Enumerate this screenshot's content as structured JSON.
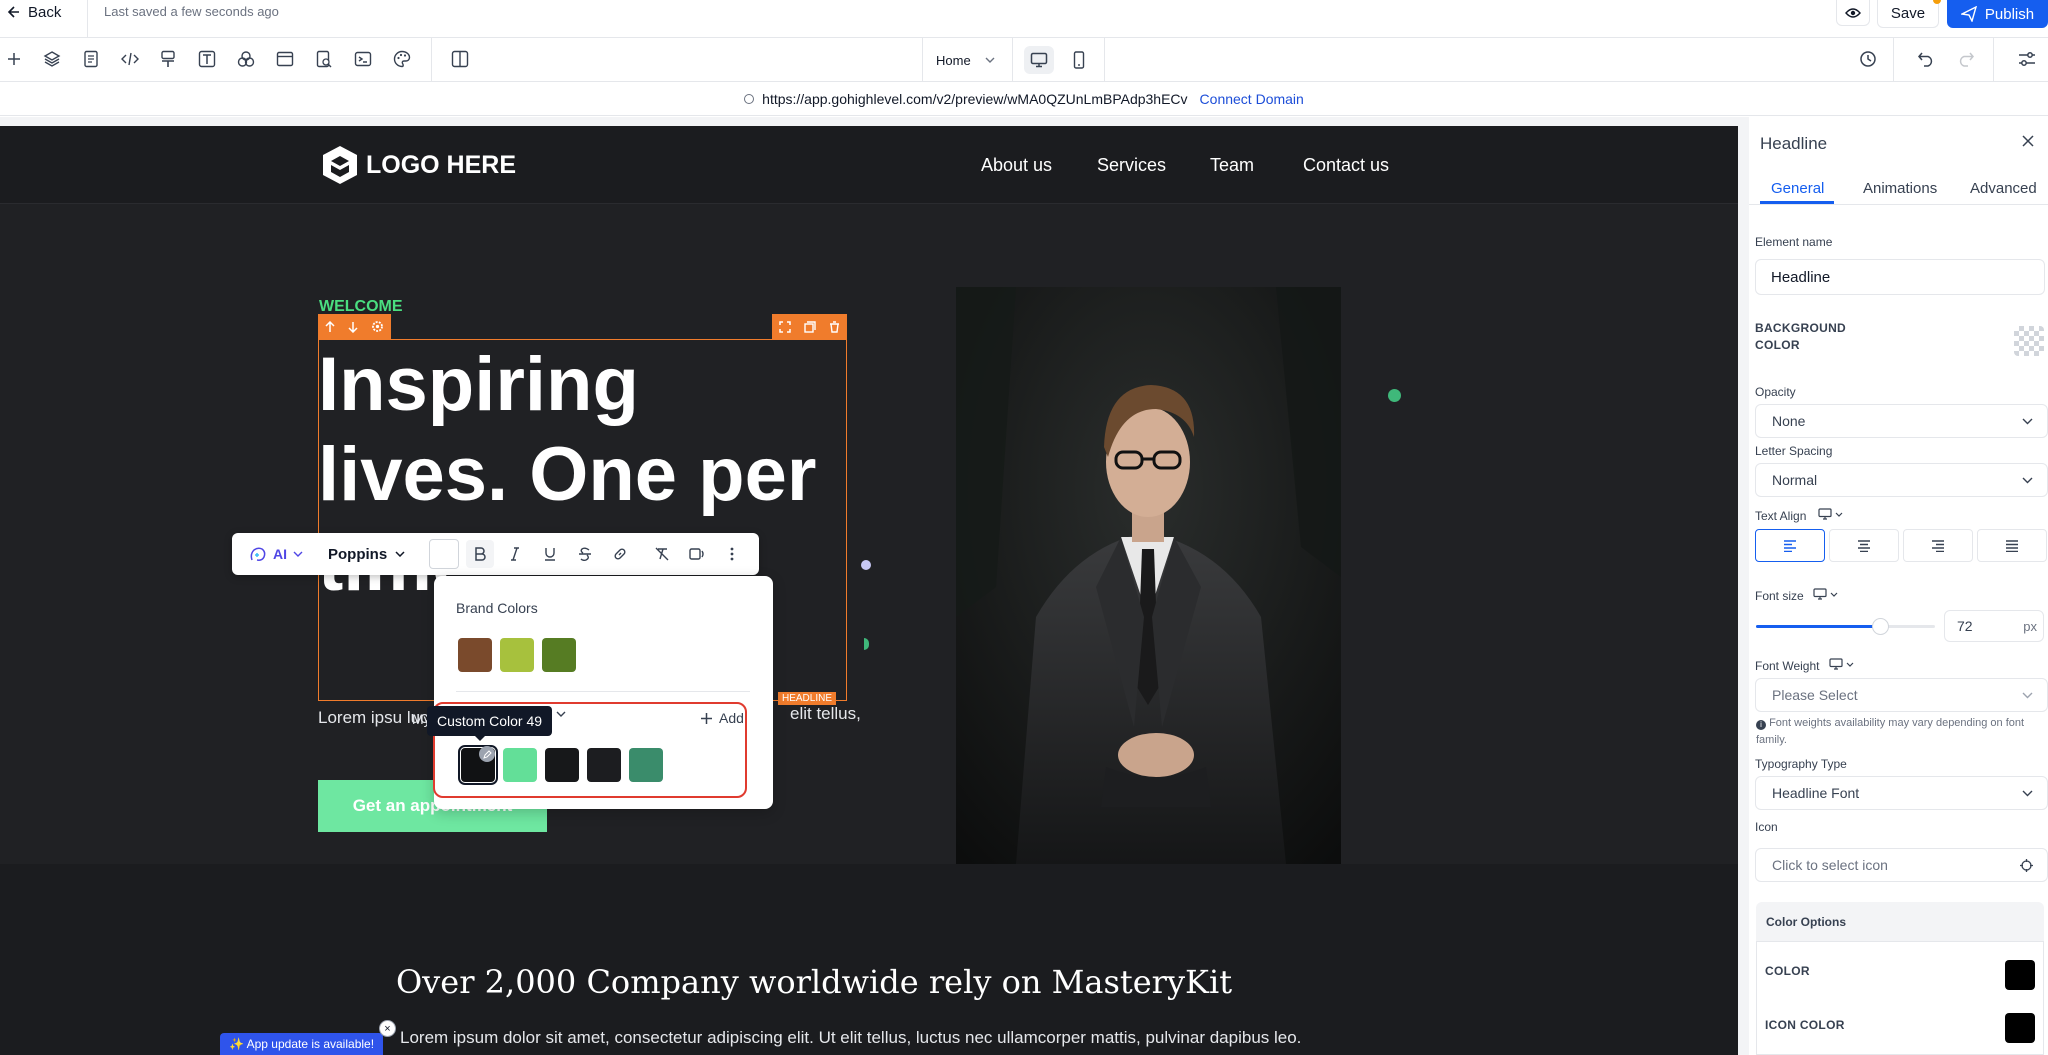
{
  "header": {
    "back_label": "Back",
    "saved_text": "Last saved a few seconds ago",
    "save_label": "Save",
    "publish_label": "Publish"
  },
  "toolbar": {
    "left_icons": [
      "add-icon",
      "layers-icon",
      "pages-icon",
      "code-icon",
      "brush-icon",
      "text-icon",
      "shapes-icon",
      "layout-icon",
      "page-search-icon",
      "terminal-icon",
      "palette-icon",
      "split-view-icon"
    ],
    "page_select": "Home",
    "right_icons": [
      "history-icon",
      "undo-icon",
      "redo-icon",
      "settings-sliders-icon"
    ]
  },
  "urlbar": {
    "url": "https://app.gohighlevel.com/v2/preview/wMA0QZUnLmBPAdp3hECv",
    "connect_label": "Connect Domain"
  },
  "site": {
    "logo_text": "LOGO HERE",
    "nav": [
      "About us",
      "Services",
      "Team",
      "Contact us"
    ],
    "welcome": "WELCOME",
    "headline": "Inspiring lives. One per time",
    "headline_tag": "HEADLINE",
    "paragraph": "Lorem ipsu luctus nec ulla",
    "paragraph_tail": "elit tellus,",
    "cta_label": "Get an appointment",
    "lower_heading": "Over 2,000 Company worldwide rely on MasteryKit",
    "lower_paragraph": "Lorem ipsum dolor sit amet, consectetur adipiscing elit. Ut elit tellus, luctus nec ullamcorper mattis, pulvinar dapibus leo."
  },
  "app_update": {
    "label": "✨ App update is available!",
    "close": "×"
  },
  "rich_text_toolbar": {
    "ai_label": "AI",
    "font_label": "Poppins",
    "buttons": [
      "bold-icon",
      "italic-icon",
      "underline-icon",
      "strikethrough-icon",
      "link-icon",
      "clear-format-icon",
      "text-to-speech-icon",
      "more-icon"
    ]
  },
  "color_popover": {
    "brand_title": "Brand Colors",
    "brand_colors": [
      "#7a4a2c",
      "#a7c13d",
      "#567c23"
    ],
    "custom_title": "My",
    "tooltip": "Custom Color 49",
    "add_label": "Add",
    "custom_colors": [
      "#111214",
      "#63df98",
      "#17181a",
      "#1c1d20",
      "#3a8c6b"
    ]
  },
  "panel": {
    "title": "Headline",
    "tabs": [
      "General",
      "Animations",
      "Advanced"
    ],
    "element_name_label": "Element name",
    "element_name_value": "Headline",
    "bg_color_label": "BACKGROUND COLOR",
    "opacity_label": "Opacity",
    "opacity_value": "None",
    "letter_spacing_label": "Letter Spacing",
    "letter_spacing_value": "Normal",
    "text_align_label": "Text Align",
    "font_size_label": "Font size",
    "font_size_value": "72",
    "font_size_unit": "px",
    "font_size_slider_fraction": 0.69,
    "font_weight_label": "Font Weight",
    "font_weight_placeholder": "Please Select",
    "font_weight_note": "Font weights availability may vary depending on font family.",
    "typography_label": "Typography Type",
    "typography_value": "Headline Font",
    "icon_label": "Icon",
    "icon_placeholder": "Click to select icon",
    "color_options_title": "Color Options",
    "color_label": "COLOR",
    "icon_color_label": "ICON COLOR"
  },
  "colors": {
    "accent": "#155eef",
    "element_orange": "#f07c2c",
    "site_green": "#4ade80",
    "site_bg": "#1b1c1f"
  }
}
